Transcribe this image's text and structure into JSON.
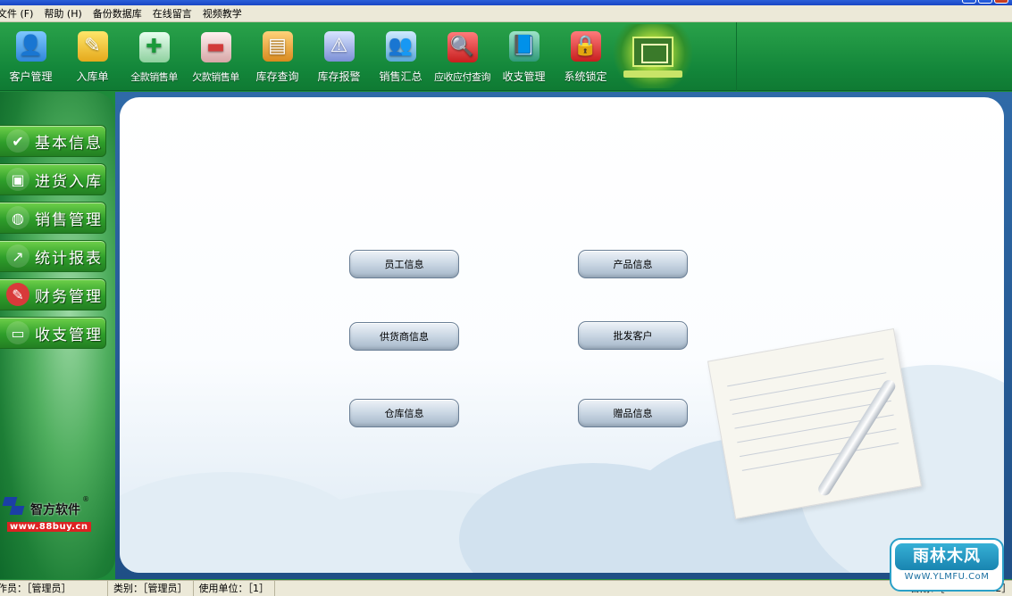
{
  "menu": {
    "items": [
      "文件 (F)",
      "帮助 (H)",
      "备份数据库",
      "在线留言",
      "视频教学"
    ]
  },
  "toolbar": {
    "items": [
      {
        "label": "客户管理",
        "icon": "user-icon",
        "glyph": "👤"
      },
      {
        "label": "入库单",
        "icon": "pencil-note-icon",
        "glyph": "✎"
      },
      {
        "label": "全款销售单",
        "icon": "add-icon",
        "glyph": "✚"
      },
      {
        "label": "欠款销售单",
        "icon": "minus-icon",
        "glyph": "▬"
      },
      {
        "label": "库存查询",
        "icon": "books-icon",
        "glyph": "▤"
      },
      {
        "label": "库存报警",
        "icon": "alert-icon",
        "glyph": "⚠"
      },
      {
        "label": "销售汇总",
        "icon": "people-icon",
        "glyph": "👥"
      },
      {
        "label": "应收应付查询",
        "icon": "folder-search-icon",
        "glyph": "🔍"
      },
      {
        "label": "收支管理",
        "icon": "book-user-icon",
        "glyph": "📘"
      },
      {
        "label": "系统锁定",
        "icon": "lock-folder-icon",
        "glyph": "🔒"
      }
    ]
  },
  "leftnav": {
    "items": [
      {
        "label": "基本信息",
        "icon": "document-icon",
        "glyph": "✔"
      },
      {
        "label": "进货入库",
        "icon": "cubes-icon",
        "glyph": "▣"
      },
      {
        "label": "销售管理",
        "icon": "globe-icon",
        "glyph": "◍"
      },
      {
        "label": "统计报表",
        "icon": "chart-icon",
        "glyph": "↗"
      },
      {
        "label": "财务管理",
        "icon": "finance-icon",
        "glyph": "✎"
      },
      {
        "label": "收支管理",
        "icon": "card-icon",
        "glyph": "▭"
      }
    ],
    "brand": {
      "name": "智方软件",
      "reg": "®",
      "url": "www.88buy.cn"
    }
  },
  "main": {
    "buttons": [
      {
        "label": "员工信息"
      },
      {
        "label": "产品信息"
      },
      {
        "label": "供货商信息"
      },
      {
        "label": "批发客户"
      },
      {
        "label": "仓库信息"
      },
      {
        "label": "赠品信息"
      }
    ]
  },
  "status": {
    "operator": "作员：［管理员］",
    "category": "类别：［管理员］",
    "unit": "使用单位：［1］",
    "date": "日期：［2016-09-22］"
  },
  "watermark": {
    "title": "雨林木风",
    "url": "WwW.YLMFU.CoM"
  }
}
